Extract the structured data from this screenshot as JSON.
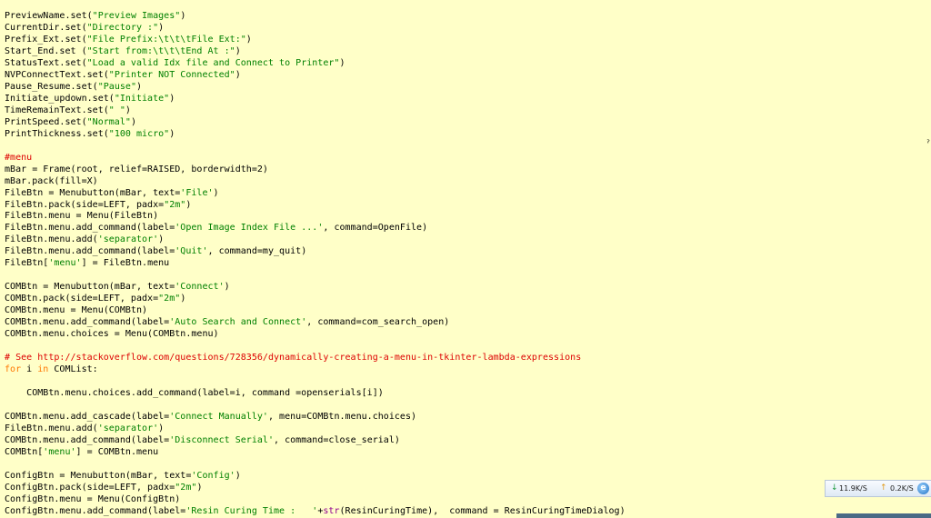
{
  "code_lines": [
    [
      {
        "t": "PreviewName.set(",
        "c": ""
      },
      {
        "t": "\"Preview Images\"",
        "c": "str"
      },
      {
        "t": ")",
        "c": ""
      }
    ],
    [
      {
        "t": "CurrentDir.set(",
        "c": ""
      },
      {
        "t": "\"Directory :\"",
        "c": "str"
      },
      {
        "t": ")",
        "c": ""
      }
    ],
    [
      {
        "t": "Prefix_Ext.set(",
        "c": ""
      },
      {
        "t": "\"File Prefix:\\t\\t\\tFile Ext:\"",
        "c": "str"
      },
      {
        "t": ")",
        "c": ""
      }
    ],
    [
      {
        "t": "Start_End.set (",
        "c": ""
      },
      {
        "t": "\"Start from:\\t\\t\\tEnd At :\"",
        "c": "str"
      },
      {
        "t": ")",
        "c": ""
      }
    ],
    [
      {
        "t": "StatusText.set(",
        "c": ""
      },
      {
        "t": "\"Load a valid Idx file and Connect to Printer\"",
        "c": "str"
      },
      {
        "t": ")",
        "c": ""
      }
    ],
    [
      {
        "t": "NVPConnectText.set(",
        "c": ""
      },
      {
        "t": "\"Printer NOT Connected\"",
        "c": "str"
      },
      {
        "t": ")",
        "c": ""
      }
    ],
    [
      {
        "t": "Pause_Resume.set(",
        "c": ""
      },
      {
        "t": "\"Pause\"",
        "c": "str"
      },
      {
        "t": ")",
        "c": ""
      }
    ],
    [
      {
        "t": "Initiate_updown.set(",
        "c": ""
      },
      {
        "t": "\"Initiate\"",
        "c": "str"
      },
      {
        "t": ")",
        "c": ""
      }
    ],
    [
      {
        "t": "TimeRemainText.set(",
        "c": ""
      },
      {
        "t": "\" \"",
        "c": "str"
      },
      {
        "t": ")",
        "c": ""
      }
    ],
    [
      {
        "t": "PrintSpeed.set(",
        "c": ""
      },
      {
        "t": "\"Normal\"",
        "c": "str"
      },
      {
        "t": ")",
        "c": ""
      }
    ],
    [
      {
        "t": "PrintThickness.set(",
        "c": ""
      },
      {
        "t": "\"100 micro\"",
        "c": "str"
      },
      {
        "t": ")",
        "c": ""
      }
    ],
    [],
    [
      {
        "t": "#menu",
        "c": "cmt"
      }
    ],
    [
      {
        "t": "mBar = Frame(root, relief=RAISED, borderwidth=2)",
        "c": ""
      }
    ],
    [
      {
        "t": "mBar.pack(fill=X)",
        "c": ""
      }
    ],
    [
      {
        "t": "FileBtn = Menubutton(mBar, text=",
        "c": ""
      },
      {
        "t": "'File'",
        "c": "str"
      },
      {
        "t": ")",
        "c": ""
      }
    ],
    [
      {
        "t": "FileBtn.pack(side=LEFT, padx=",
        "c": ""
      },
      {
        "t": "\"2m\"",
        "c": "str"
      },
      {
        "t": ")",
        "c": ""
      }
    ],
    [
      {
        "t": "FileBtn.menu = Menu(FileBtn)",
        "c": ""
      }
    ],
    [
      {
        "t": "FileBtn.menu.add_command(label=",
        "c": ""
      },
      {
        "t": "'Open Image Index File ...'",
        "c": "str"
      },
      {
        "t": ", command=OpenFile)",
        "c": ""
      }
    ],
    [
      {
        "t": "FileBtn.menu.add(",
        "c": ""
      },
      {
        "t": "'separator'",
        "c": "str"
      },
      {
        "t": ")",
        "c": ""
      }
    ],
    [
      {
        "t": "FileBtn.menu.add_command(label=",
        "c": ""
      },
      {
        "t": "'Quit'",
        "c": "str"
      },
      {
        "t": ", command=my_quit)",
        "c": ""
      }
    ],
    [
      {
        "t": "FileBtn[",
        "c": ""
      },
      {
        "t": "'menu'",
        "c": "str"
      },
      {
        "t": "] = FileBtn.menu",
        "c": ""
      }
    ],
    [],
    [
      {
        "t": "COMBtn = Menubutton(mBar, text=",
        "c": ""
      },
      {
        "t": "'Connect'",
        "c": "str"
      },
      {
        "t": ")",
        "c": ""
      }
    ],
    [
      {
        "t": "COMBtn.pack(side=LEFT, padx=",
        "c": ""
      },
      {
        "t": "\"2m\"",
        "c": "str"
      },
      {
        "t": ")",
        "c": ""
      }
    ],
    [
      {
        "t": "COMBtn.menu = Menu(COMBtn)",
        "c": ""
      }
    ],
    [
      {
        "t": "COMBtn.menu.add_command(label=",
        "c": ""
      },
      {
        "t": "'Auto Search and Connect'",
        "c": "str"
      },
      {
        "t": ", command=com_search_open)",
        "c": ""
      }
    ],
    [
      {
        "t": "COMBtn.menu.choices = Menu(COMBtn.menu)",
        "c": ""
      }
    ],
    [],
    [
      {
        "t": "# See http://stackoverflow.com/questions/728356/dynamically-creating-a-menu-in-tkinter-lambda-expressions",
        "c": "cmt"
      }
    ],
    [
      {
        "t": "for",
        "c": "kw"
      },
      {
        "t": " i ",
        "c": ""
      },
      {
        "t": "in",
        "c": "kw"
      },
      {
        "t": " COMList:",
        "c": ""
      }
    ],
    [],
    [
      {
        "t": "    COMBtn.menu.choices.add_command(label=i, command =openserials[i])",
        "c": ""
      }
    ],
    [],
    [
      {
        "t": "COMBtn.menu.add_cascade(label=",
        "c": ""
      },
      {
        "t": "'Connect Manually'",
        "c": "str"
      },
      {
        "t": ", menu=COMBtn.menu.choices)",
        "c": ""
      }
    ],
    [
      {
        "t": "FileBtn.menu.add(",
        "c": ""
      },
      {
        "t": "'separator'",
        "c": "str"
      },
      {
        "t": ")",
        "c": ""
      }
    ],
    [
      {
        "t": "COMBtn.menu.add_command(label=",
        "c": ""
      },
      {
        "t": "'Disconnect Serial'",
        "c": "str"
      },
      {
        "t": ", command=close_serial)",
        "c": ""
      }
    ],
    [
      {
        "t": "COMBtn[",
        "c": ""
      },
      {
        "t": "'menu'",
        "c": "str"
      },
      {
        "t": "] = COMBtn.menu",
        "c": ""
      }
    ],
    [],
    [
      {
        "t": "ConfigBtn = Menubutton(mBar, text=",
        "c": ""
      },
      {
        "t": "'Config'",
        "c": "str"
      },
      {
        "t": ")",
        "c": ""
      }
    ],
    [
      {
        "t": "ConfigBtn.pack(side=LEFT, padx=",
        "c": ""
      },
      {
        "t": "\"2m\"",
        "c": "str"
      },
      {
        "t": ")",
        "c": ""
      }
    ],
    [
      {
        "t": "ConfigBtn.menu = Menu(ConfigBtn)",
        "c": ""
      }
    ],
    [
      {
        "t": "ConfigBtn.menu.add_command(label=",
        "c": ""
      },
      {
        "t": "'Resin Curing Time :   '",
        "c": "str"
      },
      {
        "t": "+",
        "c": ""
      },
      {
        "t": "str",
        "c": "bi"
      },
      {
        "t": "(ResinCuringTime),  command = ResinCuringTimeDialog)",
        "c": ""
      }
    ]
  ],
  "cursor_glyph": "ˀ",
  "net_widget": {
    "down_arrow": "↓",
    "down_speed": "11.9K/S",
    "up_arrow": "↑",
    "up_speed": "0.2K/S",
    "browser_icon": "e"
  }
}
